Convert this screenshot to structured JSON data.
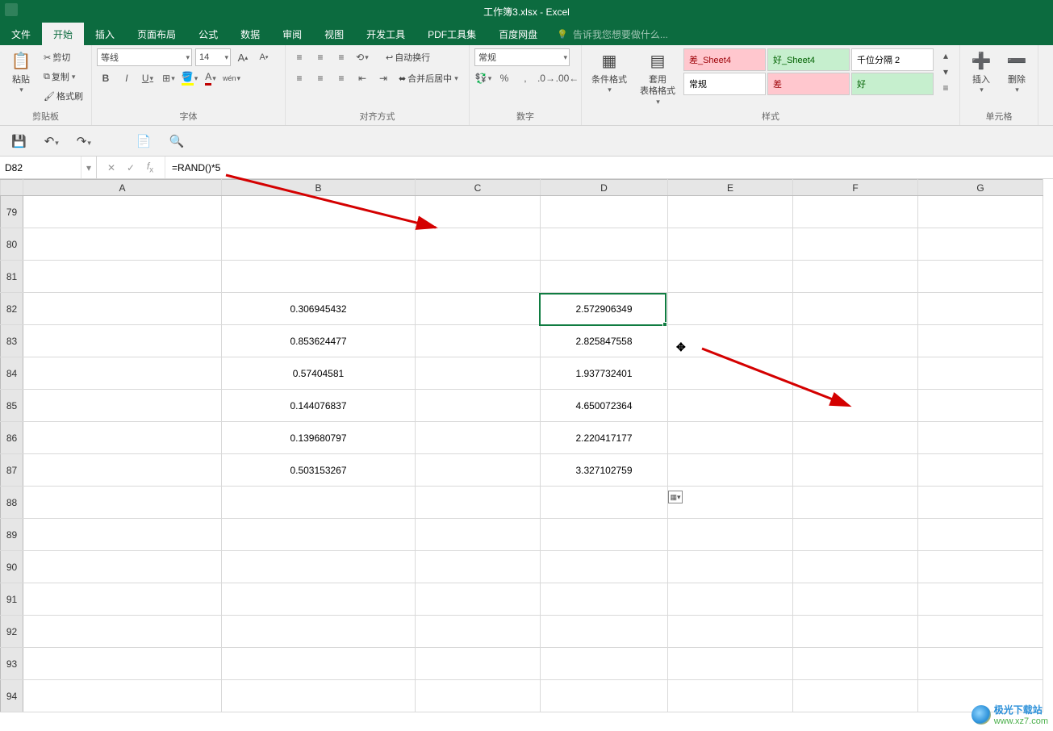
{
  "title": "工作簿3.xlsx - Excel",
  "tabs": [
    "文件",
    "开始",
    "插入",
    "页面布局",
    "公式",
    "数据",
    "审阅",
    "视图",
    "开发工具",
    "PDF工具集",
    "百度网盘"
  ],
  "tell_me": "告诉我您想要做什么...",
  "clipboard": {
    "paste": "粘贴",
    "cut": "剪切",
    "copy": "复制",
    "fmtpainter": "格式刷",
    "label": "剪贴板"
  },
  "font": {
    "name": "等线",
    "size": "14",
    "label": "字体",
    "b": "B",
    "i": "I",
    "u": "U",
    "wen": "wén"
  },
  "align": {
    "wrap": "自动换行",
    "merge": "合并后居中",
    "label": "对齐方式"
  },
  "number": {
    "fmt": "常规",
    "label": "数字"
  },
  "styles": {
    "cond": "条件格式",
    "table": "套用\n表格格式",
    "cells": {
      "bad": "差_Sheet4",
      "good": "好_Sheet4",
      "sep": "千位分隔 2",
      "normal": "常规",
      "bad2": "差",
      "good2": "好"
    },
    "label": "样式"
  },
  "cells_grp": {
    "insert": "插入",
    "delete": "删除",
    "label": "单元格"
  },
  "namebox": "D82",
  "formula": "=RAND()*5",
  "columns": [
    "",
    "A",
    "B",
    "C",
    "D",
    "E",
    "F",
    "G"
  ],
  "rows": [
    {
      "r": "79",
      "b": "",
      "d": ""
    },
    {
      "r": "80",
      "b": "",
      "d": ""
    },
    {
      "r": "81",
      "b": "",
      "d": ""
    },
    {
      "r": "82",
      "b": "0.306945432",
      "d": "2.572906349"
    },
    {
      "r": "83",
      "b": "0.853624477",
      "d": "2.825847558"
    },
    {
      "r": "84",
      "b": "0.57404581",
      "d": "1.937732401"
    },
    {
      "r": "85",
      "b": "0.144076837",
      "d": "4.650072364"
    },
    {
      "r": "86",
      "b": "0.139680797",
      "d": "2.220417177"
    },
    {
      "r": "87",
      "b": "0.503153267",
      "d": "3.327102759"
    },
    {
      "r": "88",
      "b": "",
      "d": ""
    },
    {
      "r": "89",
      "b": "",
      "d": ""
    },
    {
      "r": "90",
      "b": "",
      "d": ""
    },
    {
      "r": "91",
      "b": "",
      "d": ""
    },
    {
      "r": "92",
      "b": "",
      "d": ""
    },
    {
      "r": "93",
      "b": "",
      "d": ""
    },
    {
      "r": "94",
      "b": "",
      "d": ""
    }
  ],
  "watermark": {
    "t1": "极光下载站",
    "t2": "www.xz7.com"
  }
}
